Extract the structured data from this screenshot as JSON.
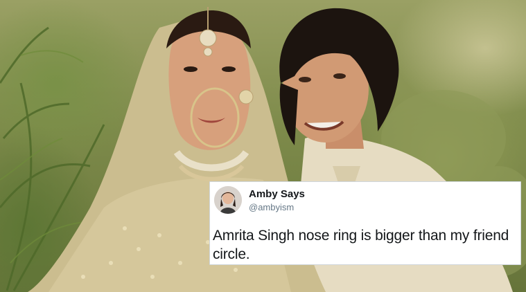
{
  "photo": {
    "description_icon": "couple-wedding-photo"
  },
  "tweet": {
    "display_name": "Amby Says",
    "handle": "@ambyism",
    "text": "Amrita Singh nose ring is bigger than my friend circle."
  },
  "colors": {
    "card_background": "#ffffff",
    "name_text": "#14171a",
    "handle_text": "#657786"
  }
}
